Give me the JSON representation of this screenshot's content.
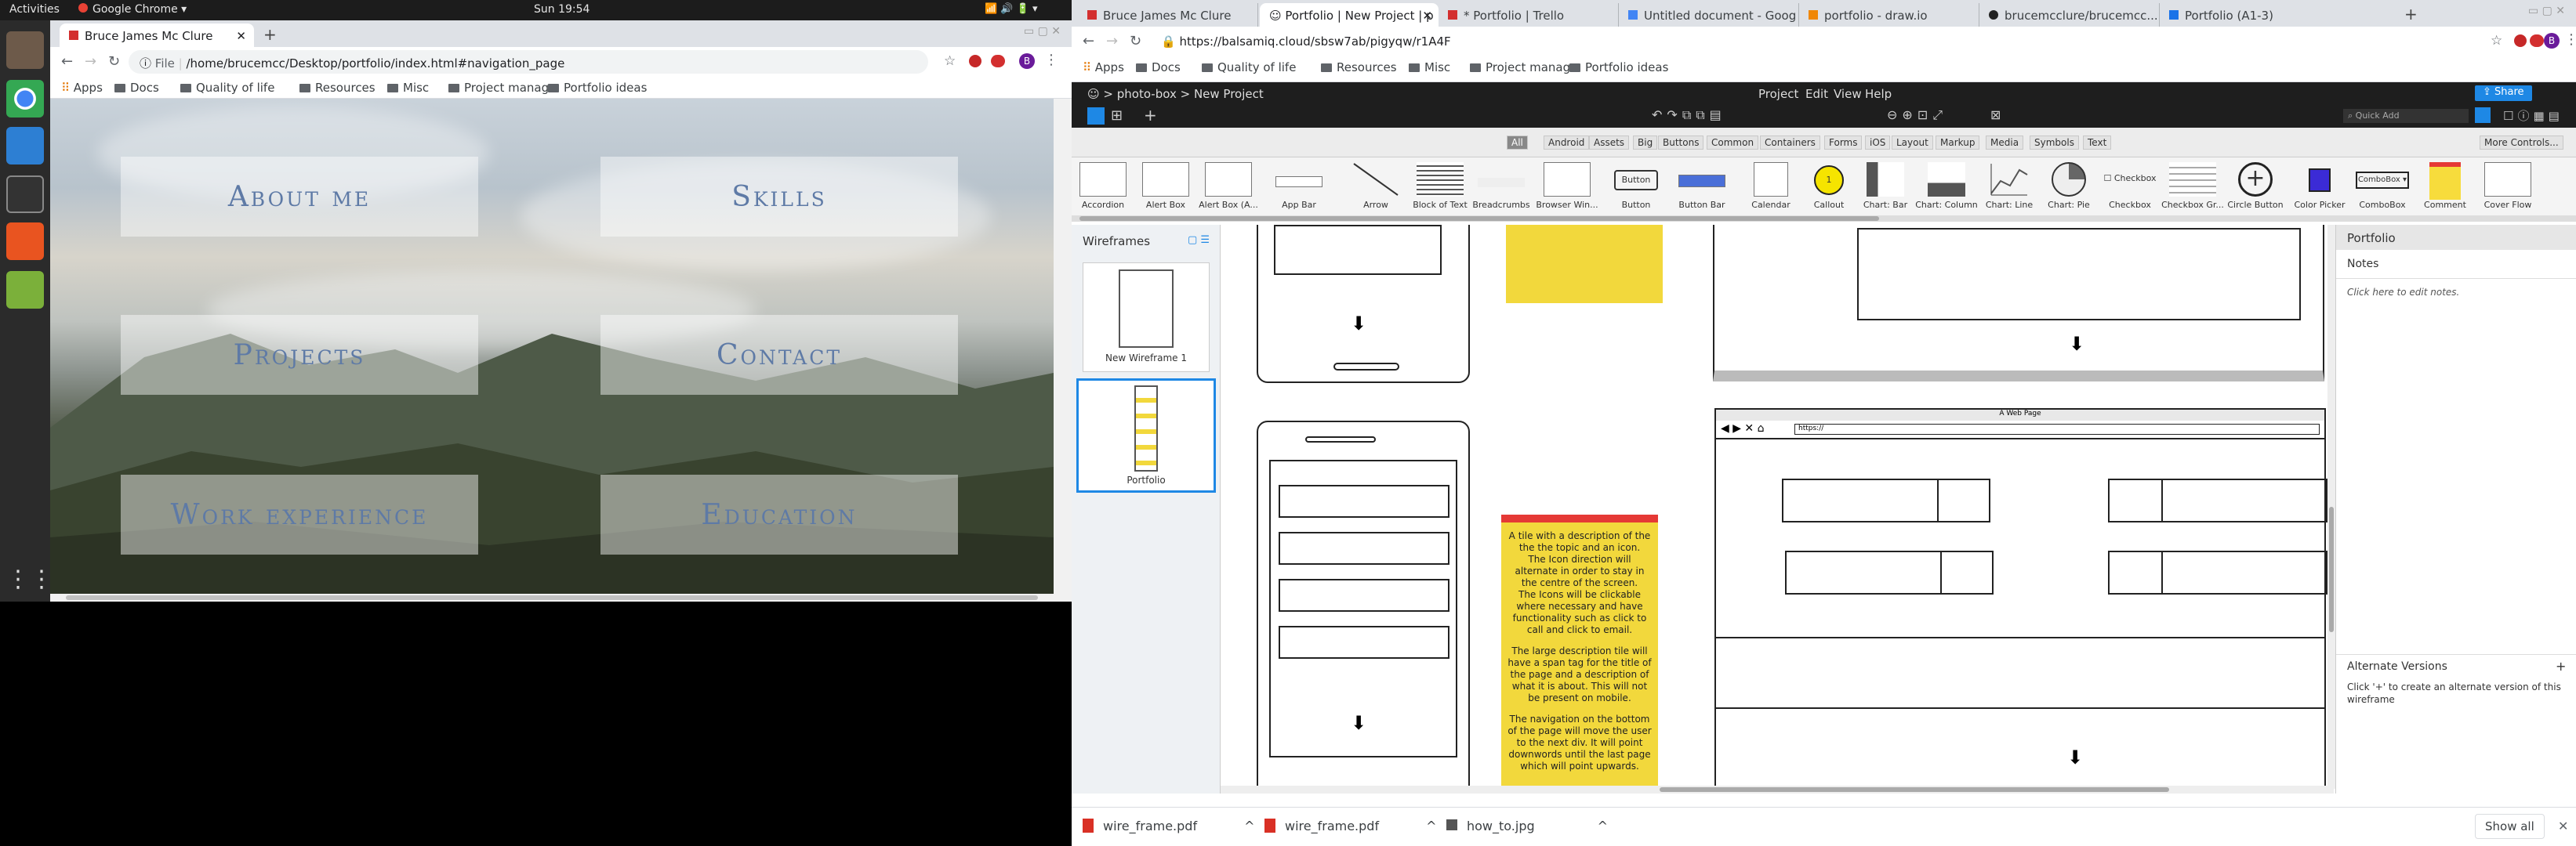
{
  "system": {
    "activities": "Activities",
    "app_menu": "Google Chrome",
    "clock": "Sun 19:54"
  },
  "left_browser": {
    "tab_title": "Bruce James Mc Clure",
    "url_scheme": "File",
    "url": "/home/brucemcc/Desktop/portfolio/index.html#navigation_page",
    "bookmarks": [
      "Apps",
      "Docs",
      "Quality of life",
      "Resources",
      "Misc",
      "Project manag...",
      "Portfolio ideas"
    ],
    "nav_tiles": [
      "About me",
      "Skills",
      "Projects",
      "Contact",
      "Work experience",
      "Education"
    ]
  },
  "right_browser": {
    "tabs": [
      "Bruce James Mc Clure",
      "Portfolio | New Project | p",
      "* Portfolio | Trello",
      "Untitled document - Goog",
      "portfolio - draw.io",
      "brucemcclure/brucemcc...",
      "Portfolio (A1-3)"
    ],
    "url": "https://balsamiq.cloud/sbsw7ab/pigyqw/r1A4F",
    "url_host": "balsamiq.cloud",
    "bookmarks": [
      "Apps",
      "Docs",
      "Quality of life",
      "Resources",
      "Misc",
      "Project manag...",
      "Portfolio ideas"
    ]
  },
  "balsamiq": {
    "breadcrumb": [
      "photo-box",
      "New Project"
    ],
    "menus": [
      "Project",
      "Edit",
      "View",
      "Help"
    ],
    "share": "Share",
    "quick_add": "Quick Add",
    "filters": [
      "All",
      "Android",
      "Assets",
      "Big",
      "Buttons",
      "Common",
      "Containers",
      "Forms",
      "iOS",
      "Layout",
      "Markup",
      "Media",
      "Symbols",
      "Text"
    ],
    "more_controls": "More Controls...",
    "library": [
      "Accordion",
      "Alert Box",
      "Alert Box (A...",
      "App Bar",
      "Arrow",
      "Block of Text",
      "Breadcrumbs",
      "Browser Win...",
      "Button",
      "Button Bar",
      "Calendar",
      "Callout",
      "Chart: Bar",
      "Chart: Column",
      "Chart: Line",
      "Chart: Pie",
      "Checkbox",
      "Checkbox Gr...",
      "Circle Button",
      "Color Picker",
      "ComboBox",
      "Comment",
      "Cover Flow"
    ],
    "button_sample": "Button",
    "checkbox_sample": "Checkbox",
    "combobox_sample": "ComboBox",
    "callout_sample": "1",
    "wireframes_title": "Wireframes",
    "wireframes": [
      "New Wireframe 1",
      "Portfolio"
    ],
    "inspector": {
      "title": "Portfolio",
      "notes_label": "Notes",
      "notes_hint": "Click here to edit notes.",
      "alt_title": "Alternate Versions",
      "alt_hint": "Click '+' to create an alternate version of this wireframe"
    },
    "webpage_title": "A Web Page",
    "webpage_url": "https://",
    "sticky_note": [
      "A tile with a description of the the the topic and an icon.",
      "The Icon direction will alternate in order to stay in the centre of the screen.",
      "The Icons will be clickable where necessary and have functionality such as click to call and click to email.",
      "The large description tile will have a span tag for the title of the page and a description of what it is about. This will not be present on mobile.",
      "The navigation on the bottom of the page will move the user to the next div. It will point downwords until the last page which will point upwards."
    ]
  },
  "downloads": {
    "files": [
      "wire_frame.pdf",
      "wire_frame.pdf",
      "how_to.jpg"
    ],
    "show_all": "Show all"
  }
}
